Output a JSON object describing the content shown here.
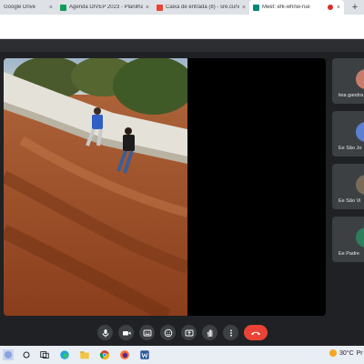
{
  "browser": {
    "tabs": [
      {
        "title": "Google Drive",
        "favicon_color": "#34a853",
        "active": false
      },
      {
        "title": "Agenda DIVEP 2023 - Planilhas G",
        "favicon_color": "#0f9d58",
        "active": false
      },
      {
        "title": "Caixa de entrada (8) - sre.curvelo",
        "favicon_color": "#ea4335",
        "active": false
      },
      {
        "title": "Meet: efk-whnw-rue",
        "favicon_color": "#00897b",
        "active": true
      }
    ],
    "close_glyph": "×",
    "new_tab_glyph": "+"
  },
  "meet": {
    "participants": [
      {
        "name": "leia gandra",
        "avatar_color": "#c77d6a"
      },
      {
        "name": "Ee São Jo",
        "avatar_color": "#5b7fd1"
      },
      {
        "name": "Ee São Vi",
        "avatar_color": "#7a6a5a"
      },
      {
        "name": "Ee Padre",
        "avatar_color": "#2e7d5b"
      }
    ],
    "controls": [
      "mic-icon",
      "camera-icon",
      "captions-icon",
      "emoji-icon",
      "present-icon",
      "raise-hand-icon",
      "more-options-icon",
      "end-call-icon"
    ],
    "end_call_color": "#ea4335"
  },
  "taskbar": {
    "temperature": "30°C",
    "condition": "Pr"
  }
}
